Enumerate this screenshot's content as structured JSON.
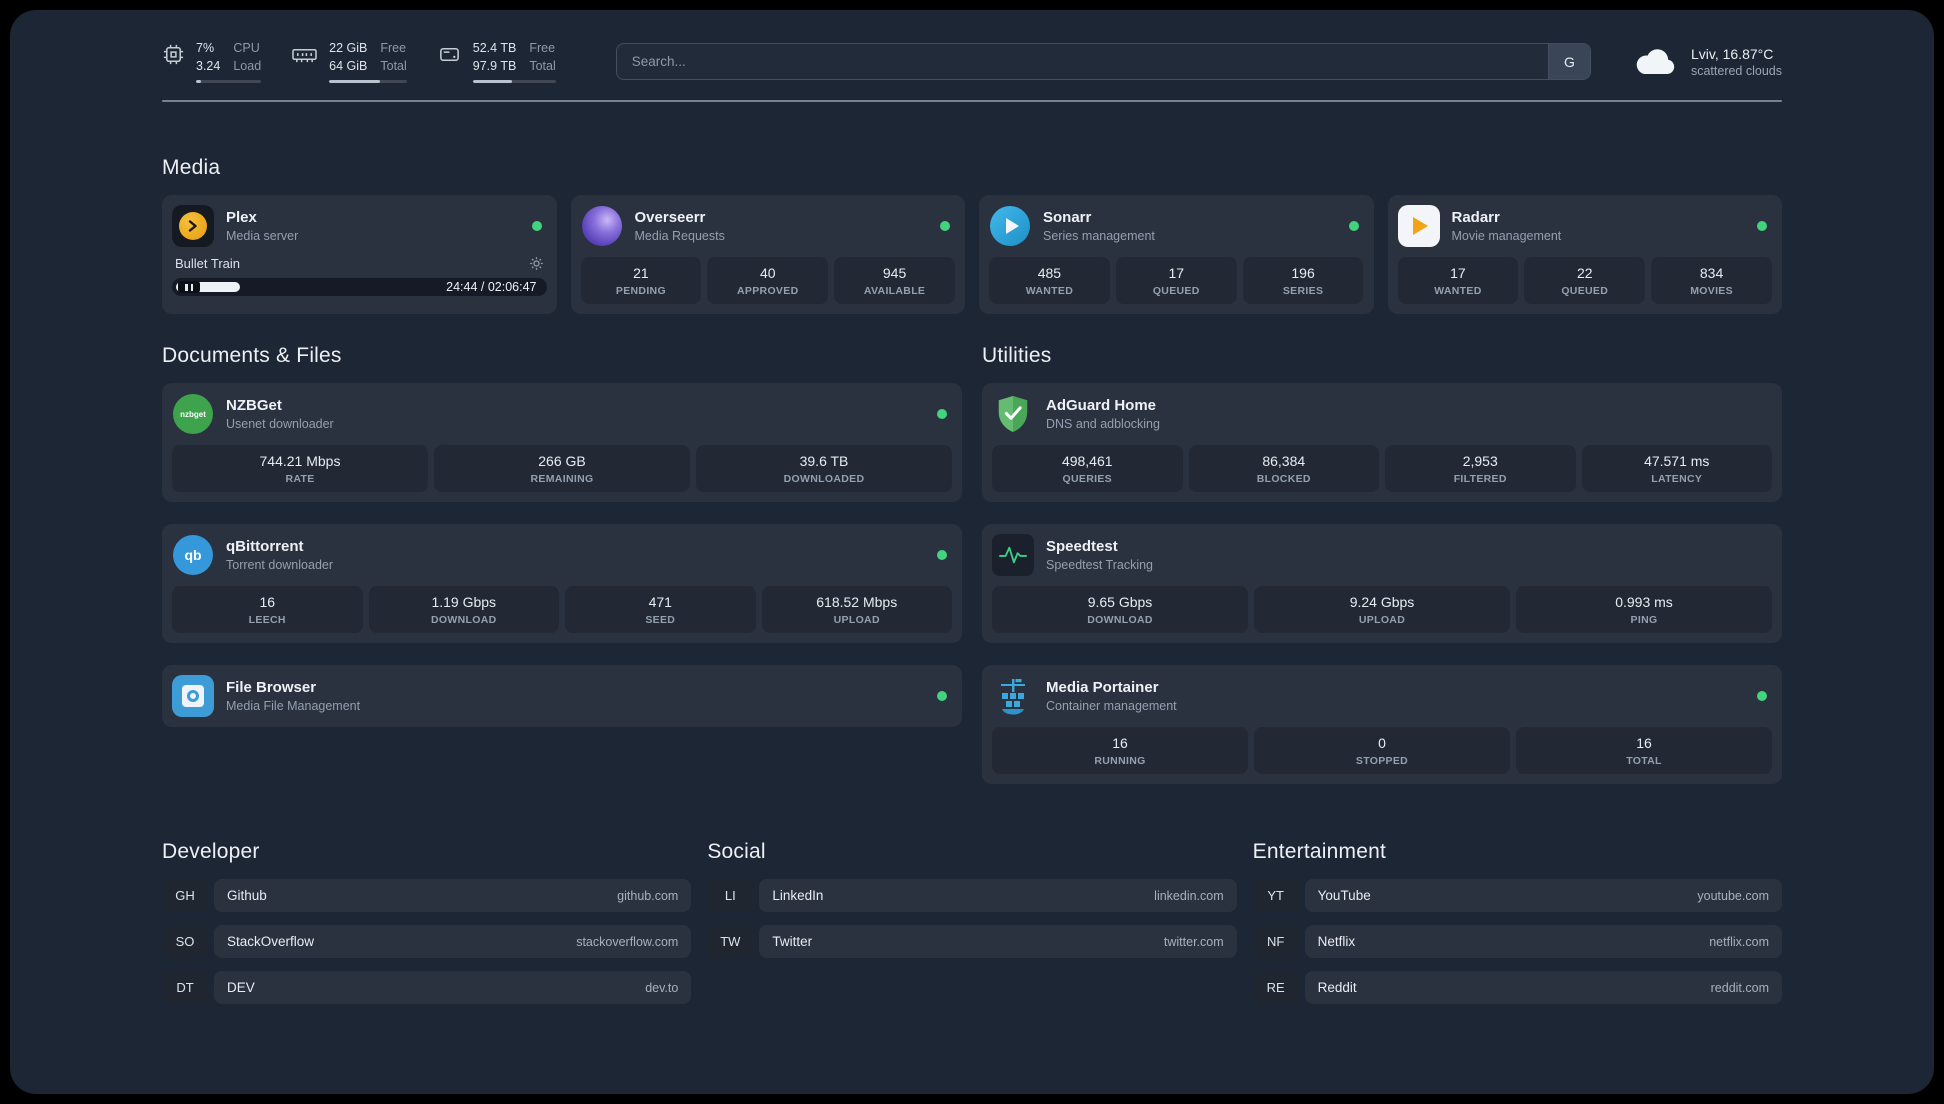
{
  "topbar": {
    "cpu": {
      "value_top": "7%",
      "value_bottom": "3.24",
      "label_top": "CPU",
      "label_bottom": "Load",
      "bar_width": "7%"
    },
    "ram": {
      "value_top": "22 GiB",
      "value_bottom": "64 GiB",
      "label_top": "Free",
      "label_bottom": "Total",
      "bar_width": "66%"
    },
    "disk": {
      "value_top": "52.4 TB",
      "value_bottom": "97.9 TB",
      "label_top": "Free",
      "label_bottom": "Total",
      "bar_width": "47%"
    },
    "search": {
      "placeholder": "Search...",
      "provider_label": "G"
    },
    "weather": {
      "location": "Lviv, 16.87°C",
      "condition": "scattered clouds"
    }
  },
  "media": {
    "heading": "Media",
    "plex": {
      "title": "Plex",
      "subtitle": "Media server",
      "now_playing": "Bullet Train",
      "time": "24:44 / 02:06:47",
      "progress_width": "17%"
    },
    "overseerr": {
      "title": "Overseerr",
      "subtitle": "Media Requests",
      "stats": [
        {
          "value": "21",
          "label": "PENDING"
        },
        {
          "value": "40",
          "label": "APPROVED"
        },
        {
          "value": "945",
          "label": "AVAILABLE"
        }
      ]
    },
    "sonarr": {
      "title": "Sonarr",
      "subtitle": "Series management",
      "stats": [
        {
          "value": "485",
          "label": "WANTED"
        },
        {
          "value": "17",
          "label": "QUEUED"
        },
        {
          "value": "196",
          "label": "SERIES"
        }
      ]
    },
    "radarr": {
      "title": "Radarr",
      "subtitle": "Movie management",
      "stats": [
        {
          "value": "17",
          "label": "WANTED"
        },
        {
          "value": "22",
          "label": "QUEUED"
        },
        {
          "value": "834",
          "label": "MOVIES"
        }
      ]
    }
  },
  "documents": {
    "heading": "Documents & Files",
    "nzbget": {
      "title": "NZBGet",
      "subtitle": "Usenet downloader",
      "icon_text": "nzbget",
      "stats": [
        {
          "value": "744.21 Mbps",
          "label": "RATE"
        },
        {
          "value": "266 GB",
          "label": "REMAINING"
        },
        {
          "value": "39.6 TB",
          "label": "DOWNLOADED"
        }
      ]
    },
    "qbittorrent": {
      "title": "qBittorrent",
      "subtitle": "Torrent downloader",
      "icon_text": "qb",
      "stats": [
        {
          "value": "16",
          "label": "LEECH"
        },
        {
          "value": "1.19 Gbps",
          "label": "DOWNLOAD"
        },
        {
          "value": "471",
          "label": "SEED"
        },
        {
          "value": "618.52 Mbps",
          "label": "UPLOAD"
        }
      ]
    },
    "filebrowser": {
      "title": "File Browser",
      "subtitle": "Media File Management"
    }
  },
  "utilities": {
    "heading": "Utilities",
    "adguard": {
      "title": "AdGuard Home",
      "subtitle": "DNS and adblocking",
      "stats": [
        {
          "value": "498,461",
          "label": "QUERIES"
        },
        {
          "value": "86,384",
          "label": "BLOCKED"
        },
        {
          "value": "2,953",
          "label": "FILTERED"
        },
        {
          "value": "47.571 ms",
          "label": "LATENCY"
        }
      ]
    },
    "speedtest": {
      "title": "Speedtest",
      "subtitle": "Speedtest Tracking",
      "stats": [
        {
          "value": "9.65 Gbps",
          "label": "DOWNLOAD"
        },
        {
          "value": "9.24 Gbps",
          "label": "UPLOAD"
        },
        {
          "value": "0.993 ms",
          "label": "PING"
        }
      ]
    },
    "portainer": {
      "title": "Media Portainer",
      "subtitle": "Container management",
      "stats": [
        {
          "value": "16",
          "label": "RUNNING"
        },
        {
          "value": "0",
          "label": "STOPPED"
        },
        {
          "value": "16",
          "label": "TOTAL"
        }
      ]
    }
  },
  "bookmarks": {
    "developer": {
      "heading": "Developer",
      "items": [
        {
          "abbr": "GH",
          "name": "Github",
          "url": "github.com"
        },
        {
          "abbr": "SO",
          "name": "StackOverflow",
          "url": "stackoverflow.com"
        },
        {
          "abbr": "DT",
          "name": "DEV",
          "url": "dev.to"
        }
      ]
    },
    "social": {
      "heading": "Social",
      "items": [
        {
          "abbr": "LI",
          "name": "LinkedIn",
          "url": "linkedin.com"
        },
        {
          "abbr": "TW",
          "name": "Twitter",
          "url": "twitter.com"
        }
      ]
    },
    "entertainment": {
      "heading": "Entertainment",
      "items": [
        {
          "abbr": "YT",
          "name": "YouTube",
          "url": "youtube.com"
        },
        {
          "abbr": "NF",
          "name": "Netflix",
          "url": "netflix.com"
        },
        {
          "abbr": "RE",
          "name": "Reddit",
          "url": "reddit.com"
        }
      ]
    }
  },
  "colors": {
    "status_online": "#43d37e",
    "accent_green": "#3bd184"
  }
}
